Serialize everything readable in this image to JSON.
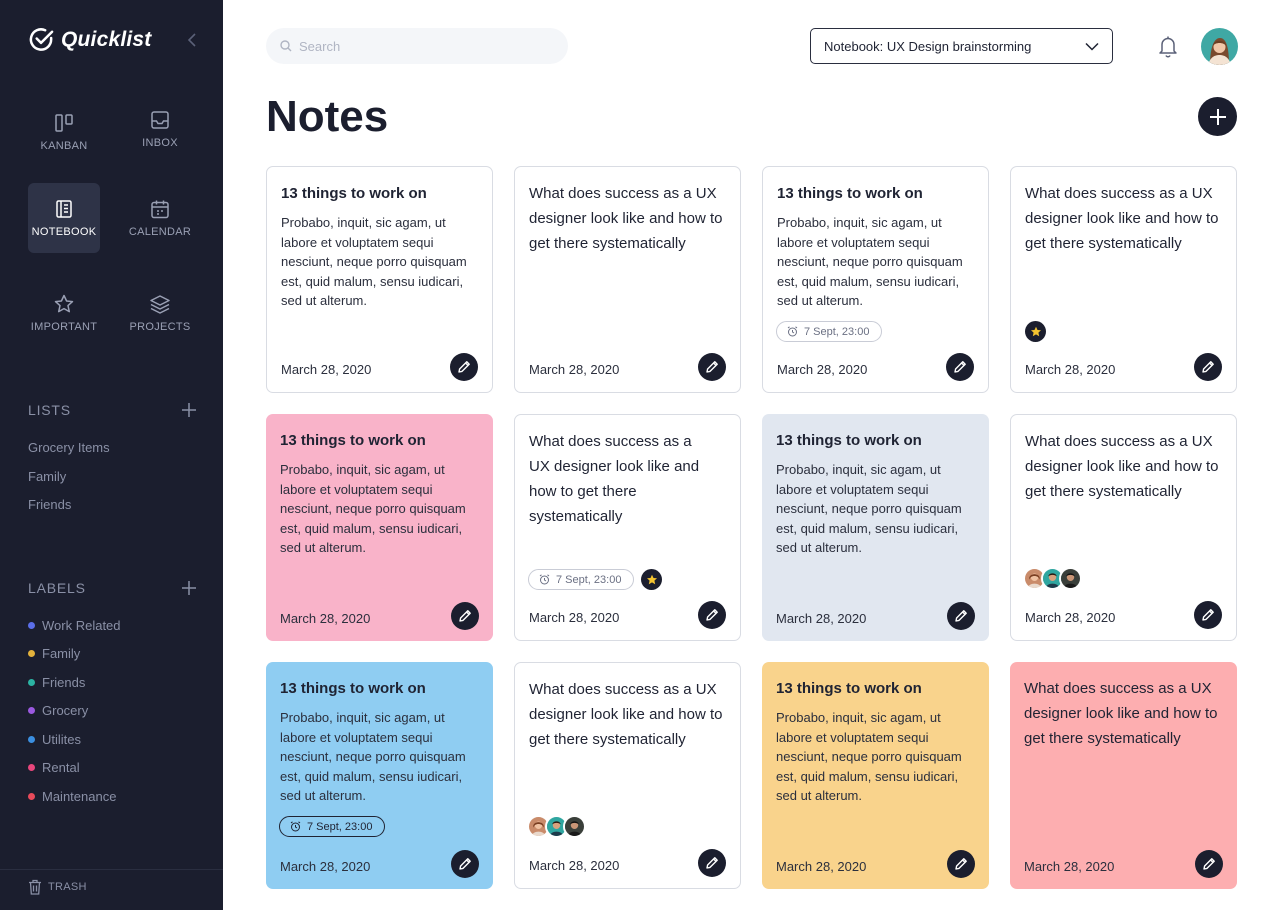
{
  "app": {
    "name": "Quicklist"
  },
  "nav": {
    "kanban": "KANBAN",
    "inbox": "INBOX",
    "notebook": "NOTEBOOK",
    "calendar": "CALENDAR",
    "important": "IMPORTANT",
    "projects": "PROJECTS"
  },
  "lists": {
    "title": "LISTS",
    "items": [
      "Grocery Items",
      "Family",
      "Friends"
    ]
  },
  "labels": {
    "title": "LABELS",
    "items": [
      {
        "name": "Work Related",
        "color": "#5b6ee8"
      },
      {
        "name": "Family",
        "color": "#e3b23c"
      },
      {
        "name": "Friends",
        "color": "#2bb3a3"
      },
      {
        "name": "Grocery",
        "color": "#9b59e0"
      },
      {
        "name": "Utilites",
        "color": "#3b8fe0"
      },
      {
        "name": "Rental",
        "color": "#e8467c"
      },
      {
        "name": "Maintenance",
        "color": "#e84a5a"
      }
    ]
  },
  "trash": "TRASH",
  "search": {
    "placeholder": "Search"
  },
  "notebook_select": {
    "value": "Notebook: UX Design brainstorming"
  },
  "page": {
    "title": "Notes"
  },
  "notes": {
    "title_a": "13 things to work on",
    "body_a": "Probabo, inquit, sic agam, ut labore et voluptatem sequi nesciunt, neque porro quisquam est, quid malum, sensu iudicari, sed ut alterum.",
    "question_a": "What does success as a UX designer look like and how to get there systematically",
    "date": "March 28, 2020",
    "reminder": "7 Sept, 23:00"
  },
  "colors": {
    "sidebar": "#1b1e2e",
    "pink": "#f9b3c9",
    "slate": "#e1e7f0",
    "blue": "#8fcdf2",
    "yellow": "#f9d38c",
    "salmon": "#fdaeb0"
  }
}
